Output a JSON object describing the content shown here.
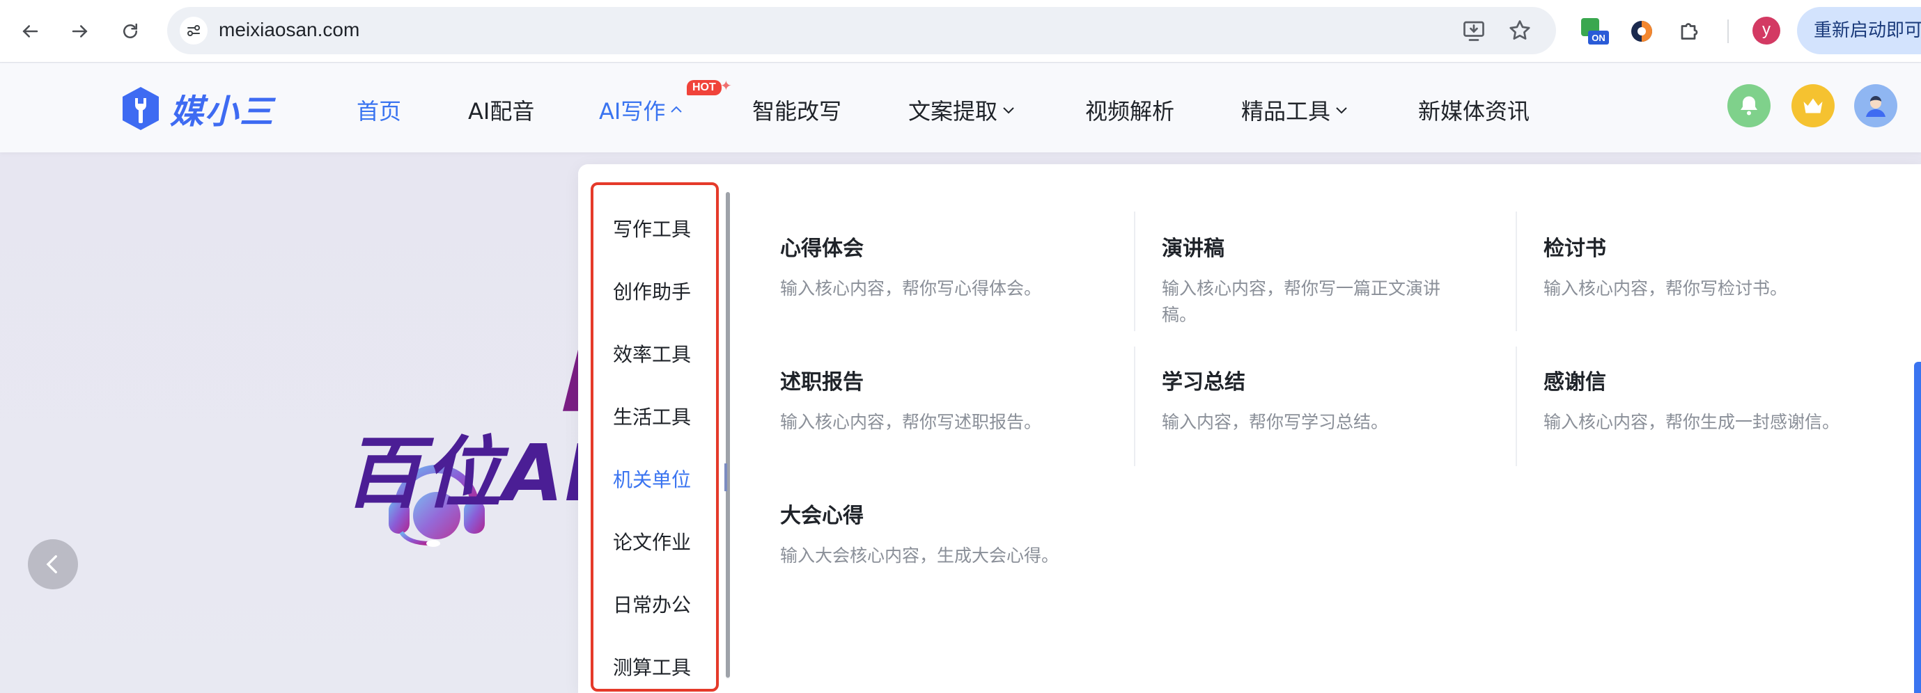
{
  "browser": {
    "url": "meixiaosan.com",
    "profile_initial": "y",
    "relaunch_label": "重新启动即可",
    "extension_badge": "ON",
    "icons": [
      "back-icon",
      "forward-icon",
      "reload-icon",
      "site-settings-icon",
      "install-app-icon",
      "bookmark-star-icon",
      "extension-on-icon",
      "sync-icon",
      "extensions-puzzle-icon"
    ]
  },
  "site": {
    "logo_text": "媒小三",
    "nav": [
      {
        "label": "首页",
        "active": true
      },
      {
        "label": "AI配音"
      },
      {
        "label": "AI写作",
        "badge": "HOT",
        "open": true
      },
      {
        "label": "智能改写"
      },
      {
        "label": "文案提取",
        "has_dropdown": true
      },
      {
        "label": "视频解析"
      },
      {
        "label": "精品工具",
        "has_dropdown": true
      },
      {
        "label": "新媒体资讯"
      }
    ],
    "header_icons": [
      "bell-icon",
      "crown-icon",
      "user-avatar-icon"
    ],
    "accent_color": "#3a74f0"
  },
  "hero": {
    "bracket_text": "【媒",
    "title_text": "百位AI配"
  },
  "dropdown": {
    "categories": [
      {
        "label": "写作工具"
      },
      {
        "label": "创作助手"
      },
      {
        "label": "效率工具"
      },
      {
        "label": "生活工具"
      },
      {
        "label": "机关单位",
        "active": true
      },
      {
        "label": "论文作业"
      },
      {
        "label": "日常办公"
      },
      {
        "label": "测算工具"
      }
    ],
    "tools": [
      {
        "title": "心得体会",
        "desc": "输入核心内容，帮你写心得体会。"
      },
      {
        "title": "演讲稿",
        "desc": "输入核心内容，帮你写一篇正文演讲稿。"
      },
      {
        "title": "检讨书",
        "desc": "输入核心内容，帮你写检讨书。"
      },
      {
        "title": "述职报告",
        "desc": "输入核心内容，帮你写述职报告。"
      },
      {
        "title": "学习总结",
        "desc": "输入内容，帮你写学习总结。"
      },
      {
        "title": "感谢信",
        "desc": "输入核心内容，帮你生成一封感谢信。"
      },
      {
        "title": "大会心得",
        "desc": "输入大会核心内容，生成大会心得。"
      }
    ]
  }
}
